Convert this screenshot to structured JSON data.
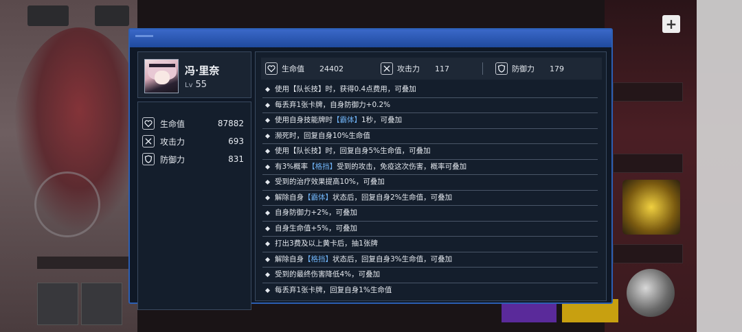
{
  "character": {
    "name": "冯·里奈",
    "level_label": "Lv",
    "level": "55"
  },
  "side_stats": [
    {
      "label": "生命值",
      "value": "87882",
      "icon": "heart-shield-icon"
    },
    {
      "label": "攻击力",
      "value": "693",
      "icon": "crossed-swords-icon"
    },
    {
      "label": "防御力",
      "value": "831",
      "icon": "shield-icon"
    }
  ],
  "top_stats": [
    {
      "label": "生命值",
      "value": "24402",
      "icon": "heart-shield-icon"
    },
    {
      "label": "攻击力",
      "value": "117",
      "icon": "crossed-swords-icon"
    },
    {
      "label": "防御力",
      "value": "179",
      "icon": "shield-icon"
    }
  ],
  "skills": [
    {
      "pre": "使用【队长技】时，获得0.4点费用，可叠加",
      "kw": "",
      "post": ""
    },
    {
      "pre": "每丢弃1张卡牌，自身防御力+0.2%",
      "kw": "",
      "post": ""
    },
    {
      "pre": "使用自身技能牌时",
      "kw": "【霸体】",
      "post": "1秒，可叠加"
    },
    {
      "pre": "濒死时，回复自身10%生命值",
      "kw": "",
      "post": ""
    },
    {
      "pre": "使用【队长技】时，回复自身5%生命值，可叠加",
      "kw": "",
      "post": ""
    },
    {
      "pre": "有3%概率",
      "kw": "【格挡】",
      "post": "受到的攻击，免疫这次伤害，概率可叠加"
    },
    {
      "pre": "受到的治疗效果提高10%，可叠加",
      "kw": "",
      "post": ""
    },
    {
      "pre": "解除自身",
      "kw": "【霸体】",
      "post": "状态后，回复自身2%生命值，可叠加"
    },
    {
      "pre": "自身防御力+2%，可叠加",
      "kw": "",
      "post": ""
    },
    {
      "pre": "自身生命值+5%，可叠加",
      "kw": "",
      "post": ""
    },
    {
      "pre": "打出3费及以上黄卡后，抽1张牌",
      "kw": "",
      "post": ""
    },
    {
      "pre": "解除自身",
      "kw": "【格挡】",
      "post": "状态后，回复自身3%生命值，可叠加"
    },
    {
      "pre": "受到的最终伤害降低4%，可叠加",
      "kw": "",
      "post": ""
    },
    {
      "pre": "每丢弃1张卡牌，回复自身1%生命值",
      "kw": "",
      "post": ""
    }
  ],
  "colors": {
    "accent": "#2c5fb4",
    "keyword": "#6fb2f4",
    "panel": "#141e2c"
  }
}
